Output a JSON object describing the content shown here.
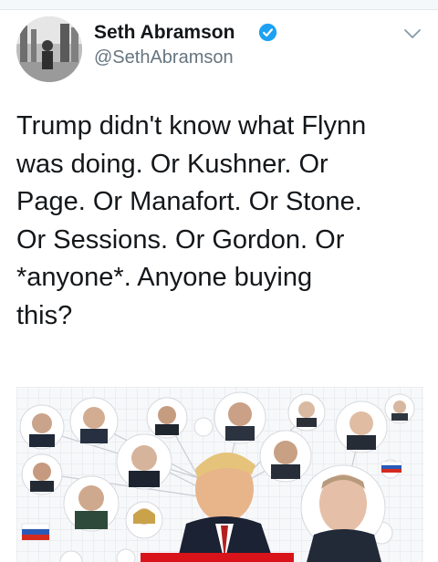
{
  "author": {
    "display_name": "Seth Abramson",
    "handle": "@SethAbramson",
    "verified": true
  },
  "tweet": {
    "text_lines": [
      "Trump didn't know what Flynn",
      "was doing. Or Kushner. Or",
      "Page. Or Manafort. Or Stone.",
      "Or Sessions. Or Gordon. Or",
      "*anyone*. Anyone buying",
      "this?"
    ]
  },
  "icons": {
    "verified": "verified-badge-icon",
    "menu": "chevron-down-icon"
  },
  "colors": {
    "verified": "#1da1f2",
    "handle": "#66757f",
    "text": "#14171a",
    "media_banner": "#d8141a"
  }
}
